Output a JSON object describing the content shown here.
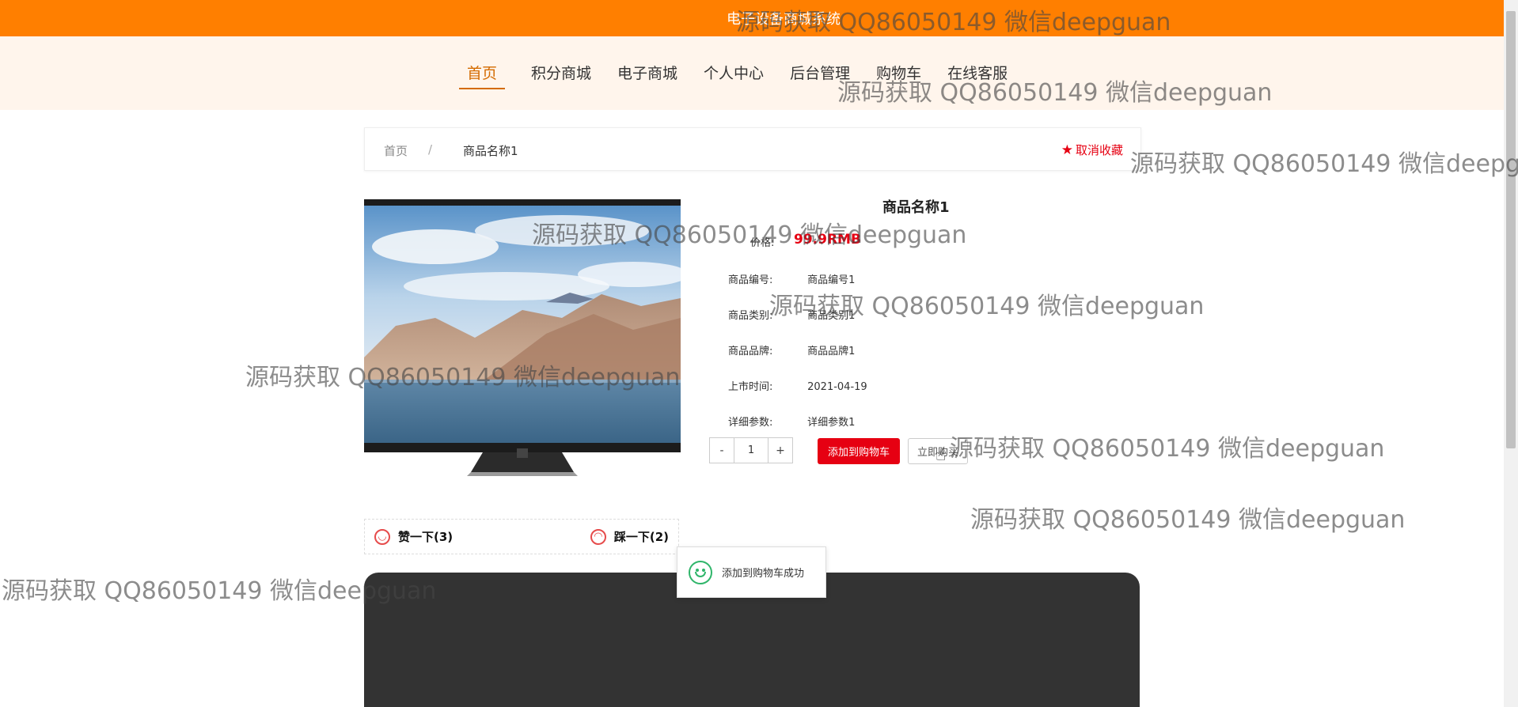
{
  "topbar": {
    "site_title": "电子设备商城系统"
  },
  "nav": {
    "items": [
      "首页",
      "积分商城",
      "电子商城",
      "个人中心",
      "后台管理",
      "购物车",
      "在线客服"
    ],
    "active_index": 0
  },
  "breadcrumb": {
    "home": "首页",
    "separator": "/",
    "current": "商品名称1"
  },
  "favorite": {
    "label": "取消收藏"
  },
  "product": {
    "name": "商品名称1",
    "price_label": "价格:",
    "price_value": "99.9RMB",
    "details": [
      {
        "label": "商品编号:",
        "value": "商品编号1"
      },
      {
        "label": "商品类别:",
        "value": "商品类别1"
      },
      {
        "label": "商品品牌:",
        "value": "商品品牌1"
      },
      {
        "label": "上市时间:",
        "value": "2021-04-19"
      },
      {
        "label": "详细参数:",
        "value": "详细参数1"
      }
    ]
  },
  "purchase": {
    "minus": "-",
    "quantity": "1",
    "plus": "+",
    "add_to_cart": "添加到购物车",
    "buy_now": "立即购买"
  },
  "votes": {
    "like": "赞一下(3)",
    "dislike": "踩一下(2)"
  },
  "toast": {
    "message": "添加到购物车成功"
  },
  "watermark": {
    "text": "源码获取 QQ86050149 微信deepguan"
  },
  "colors": {
    "accent": "#ff7f00",
    "nav_active": "#d46b00",
    "danger": "#e60012",
    "success": "#2fb56a",
    "footer": "#333333"
  }
}
